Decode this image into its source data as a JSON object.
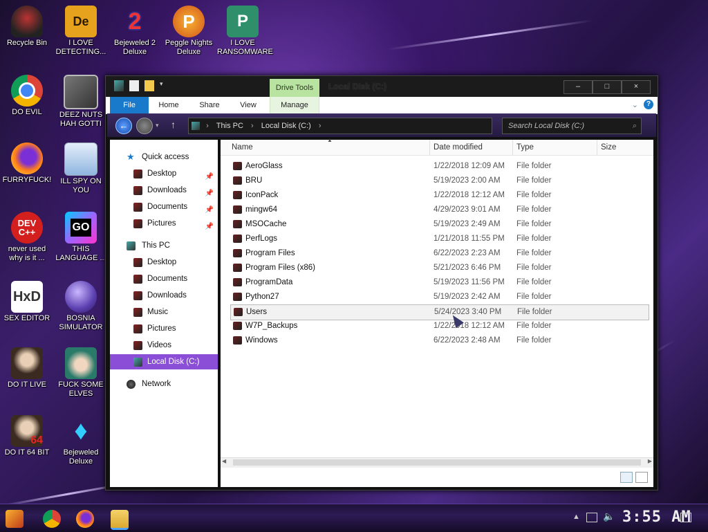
{
  "desktop": {
    "icons": [
      {
        "label": "Recycle Bin"
      },
      {
        "label": "I LOVE DETECTING..."
      },
      {
        "label": "Bejeweled 2 Deluxe"
      },
      {
        "label": "Peggle Nights Deluxe"
      },
      {
        "label": "I LOVE RANSOMWARE"
      },
      {
        "label": "DO EVIL"
      },
      {
        "label": "DEEZ NUTS HAH GOTTI"
      },
      {
        "label": "FURRYFUCK!"
      },
      {
        "label": "ILL SPY ON YOU"
      },
      {
        "label": "never used why is it ..."
      },
      {
        "label": "THIS LANGUAGE ..."
      },
      {
        "label": "SEX EDITOR"
      },
      {
        "label": "BOSNIA SIMULATOR"
      },
      {
        "label": "DO IT LIVE"
      },
      {
        "label": "FUCK SOME ELVES"
      },
      {
        "label": "DO IT 64 BIT"
      },
      {
        "label": "Bejeweled Deluxe"
      }
    ]
  },
  "window": {
    "title": "Local Disk (C:)",
    "contextual_tab": "Drive Tools",
    "ribbon_tabs": [
      "File",
      "Home",
      "Share",
      "View",
      "Manage"
    ],
    "breadcrumb": [
      "This PC",
      "Local Disk (C:)"
    ],
    "search_placeholder": "Search Local Disk (C:)",
    "controls": {
      "minimize": "–",
      "maximize": "□",
      "close": "×"
    }
  },
  "sidebar": {
    "quick_access": "Quick access",
    "quick_items": [
      "Desktop",
      "Downloads",
      "Documents",
      "Pictures"
    ],
    "this_pc": "This PC",
    "pc_items": [
      "Desktop",
      "Documents",
      "Downloads",
      "Music",
      "Pictures",
      "Videos",
      "Local Disk (C:)"
    ],
    "network": "Network"
  },
  "columns": [
    "Name",
    "Date modified",
    "Type",
    "Size"
  ],
  "files": [
    {
      "name": "AeroGlass",
      "date": "1/22/2018 12:09 AM",
      "type": "File folder"
    },
    {
      "name": "BRU",
      "date": "5/19/2023 2:00 AM",
      "type": "File folder"
    },
    {
      "name": "IconPack",
      "date": "1/22/2018 12:12 AM",
      "type": "File folder"
    },
    {
      "name": "mingw64",
      "date": "4/29/2023 9:01 AM",
      "type": "File folder"
    },
    {
      "name": "MSOCache",
      "date": "5/19/2023 2:49 AM",
      "type": "File folder"
    },
    {
      "name": "PerfLogs",
      "date": "1/21/2018 11:55 PM",
      "type": "File folder"
    },
    {
      "name": "Program Files",
      "date": "6/22/2023 2:23 AM",
      "type": "File folder"
    },
    {
      "name": "Program Files (x86)",
      "date": "5/21/2023 6:46 PM",
      "type": "File folder"
    },
    {
      "name": "ProgramData",
      "date": "5/19/2023 11:56 PM",
      "type": "File folder"
    },
    {
      "name": "Python27",
      "date": "5/19/2023 2:42 AM",
      "type": "File folder"
    },
    {
      "name": "Users",
      "date": "5/24/2023 3:40 PM",
      "type": "File folder"
    },
    {
      "name": "W7P_Backups",
      "date": "1/22/2018 12:12 AM",
      "type": "File folder"
    },
    {
      "name": "Windows",
      "date": "6/22/2023 2:48 AM",
      "type": "File folder"
    }
  ],
  "taskbar": {
    "clock": "3:55 AM"
  },
  "colors": {
    "accent": "#8a4fd6",
    "file_tab": "#1979ca",
    "drive_tools": "#b8e3a0"
  }
}
